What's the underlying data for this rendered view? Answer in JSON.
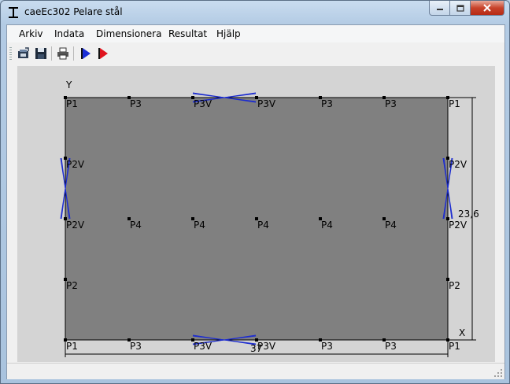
{
  "window": {
    "title": "caeEc302 Pelare stål",
    "icon": "i-beam-icon"
  },
  "menu": {
    "items": [
      "Arkiv",
      "Indata",
      "Dimensionera",
      "Resultat",
      "Hjälp"
    ]
  },
  "toolbar": {
    "buttons": [
      "open-icon",
      "save-icon",
      "print-icon",
      "run-blue-icon",
      "run-red-icon"
    ]
  },
  "diagram": {
    "axis_y_label": "Y",
    "axis_x_label": "X",
    "width_value": "37",
    "height_value": "23,6",
    "top_row": [
      "P1",
      "P3",
      "P3V",
      "P3V",
      "P3",
      "P3",
      "P1"
    ],
    "row2": [
      "P2V",
      "P2V"
    ],
    "middle_row": [
      "P2V",
      "P4",
      "P4",
      "P4",
      "P4",
      "P4",
      "P2V"
    ],
    "row4": [
      "P2",
      "P2"
    ],
    "bottom_row": [
      "P1",
      "P3",
      "P3V",
      "P3V",
      "P3",
      "P3",
      "P1"
    ],
    "colors": {
      "plate": "#808080",
      "background": "#d4d4d4",
      "brace": "#1b2bd0"
    }
  }
}
